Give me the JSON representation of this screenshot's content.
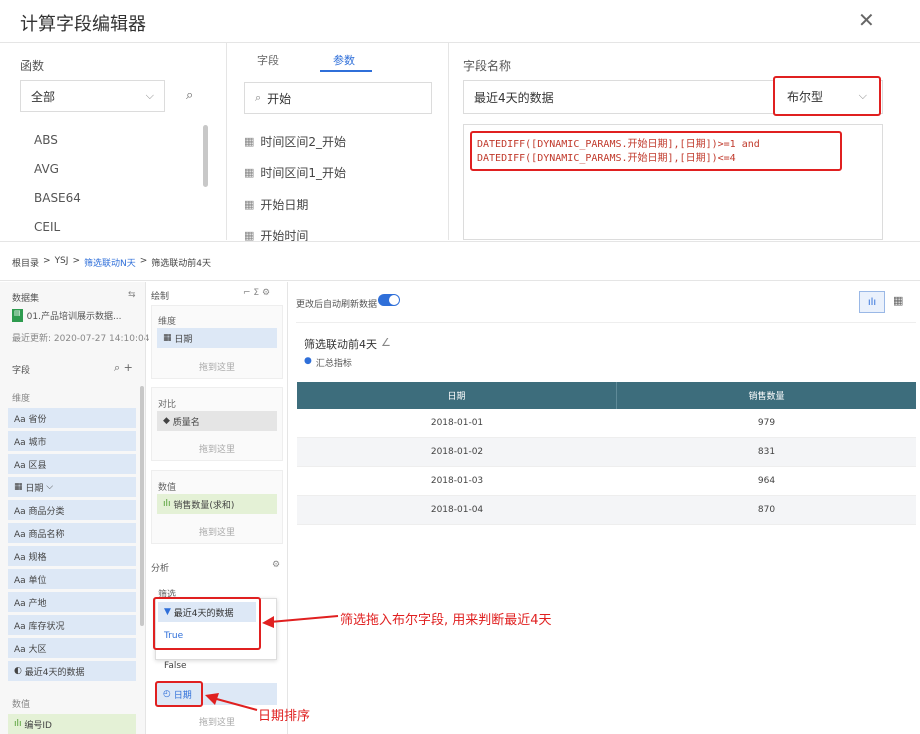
{
  "dialog": {
    "title": "计算字段编辑器",
    "close_glyph": "✕",
    "functions": {
      "header": "函数",
      "filter_value": "全部",
      "items": [
        "ABS",
        "AVG",
        "BASE64",
        "CEIL"
      ]
    },
    "tabs": [
      "字段",
      "参数"
    ],
    "active_tab": "参数",
    "param_search": "开始",
    "params": [
      "时间区间2_开始",
      "时间区间1_开始",
      "开始日期",
      "开始时间"
    ],
    "field_name_label": "字段名称",
    "field_name_value": "最近4天的数据",
    "type_value": "布尔型",
    "formula_line1": "DATEDIFF([DYNAMIC_PARAMS.开始日期],[日期])>=1 and",
    "formula_line2": "DATEDIFF([DYNAMIC_PARAMS.开始日期],[日期])<=4"
  },
  "breadcrumb": [
    "根目录",
    "YSJ",
    "筛选联动N天",
    "筛选联动前4天"
  ],
  "sidebar": {
    "dataset_label": "数据集",
    "dataset_name": "01.产品培训展示数据...",
    "updated": "最近更新: 2020-07-27 14:10:04",
    "fields_label": "字段",
    "dim_label": "维度",
    "dimensions": [
      "Aa 省份",
      "Aa 城市",
      "Aa 区县",
      "日期",
      "Aa 商品分类",
      "Aa 商品名称",
      "Aa 规格",
      "Aa 单位",
      "Aa 产地",
      "Aa 库存状况",
      "Aa 大区",
      "最近4天的数据"
    ],
    "date_field": "日期",
    "measure_label": "数值",
    "measure_first": "编号ID"
  },
  "config": {
    "draw_label": "绘制",
    "dim_section": "维度",
    "dim_chip": "日期",
    "dim_drop": "拖到这里",
    "compare_section": "对比",
    "compare_chip": "质量名",
    "compare_drop": "拖到这里",
    "value_section": "数值",
    "value_chip": "销售数量(求和)",
    "value_drop": "拖到这里",
    "analysis_label": "分析",
    "filter_label": "筛选",
    "filter_chip": "最近4天的数据",
    "option_true": "True",
    "option_false": "False",
    "sort_chip": "日期",
    "sort_drop": "拖到这里"
  },
  "canvas": {
    "auto_refresh": "更改后自动刷新数据",
    "report_title": "筛选联动前4天",
    "summary": "汇总指标",
    "columns": [
      "日期",
      "销售数量"
    ],
    "rows": [
      [
        "2018-01-01",
        "979"
      ],
      [
        "2018-01-02",
        "831"
      ],
      [
        "2018-01-03",
        "964"
      ],
      [
        "2018-01-04",
        "870"
      ]
    ]
  },
  "annotations": {
    "filter_note": "筛选拖入布尔字段, 用来判断最近4天",
    "sort_note": "日期排序"
  },
  "colors": {
    "accent": "#2f6fd9",
    "highlight": "#e02020",
    "table_header": "#3d6d7c"
  }
}
